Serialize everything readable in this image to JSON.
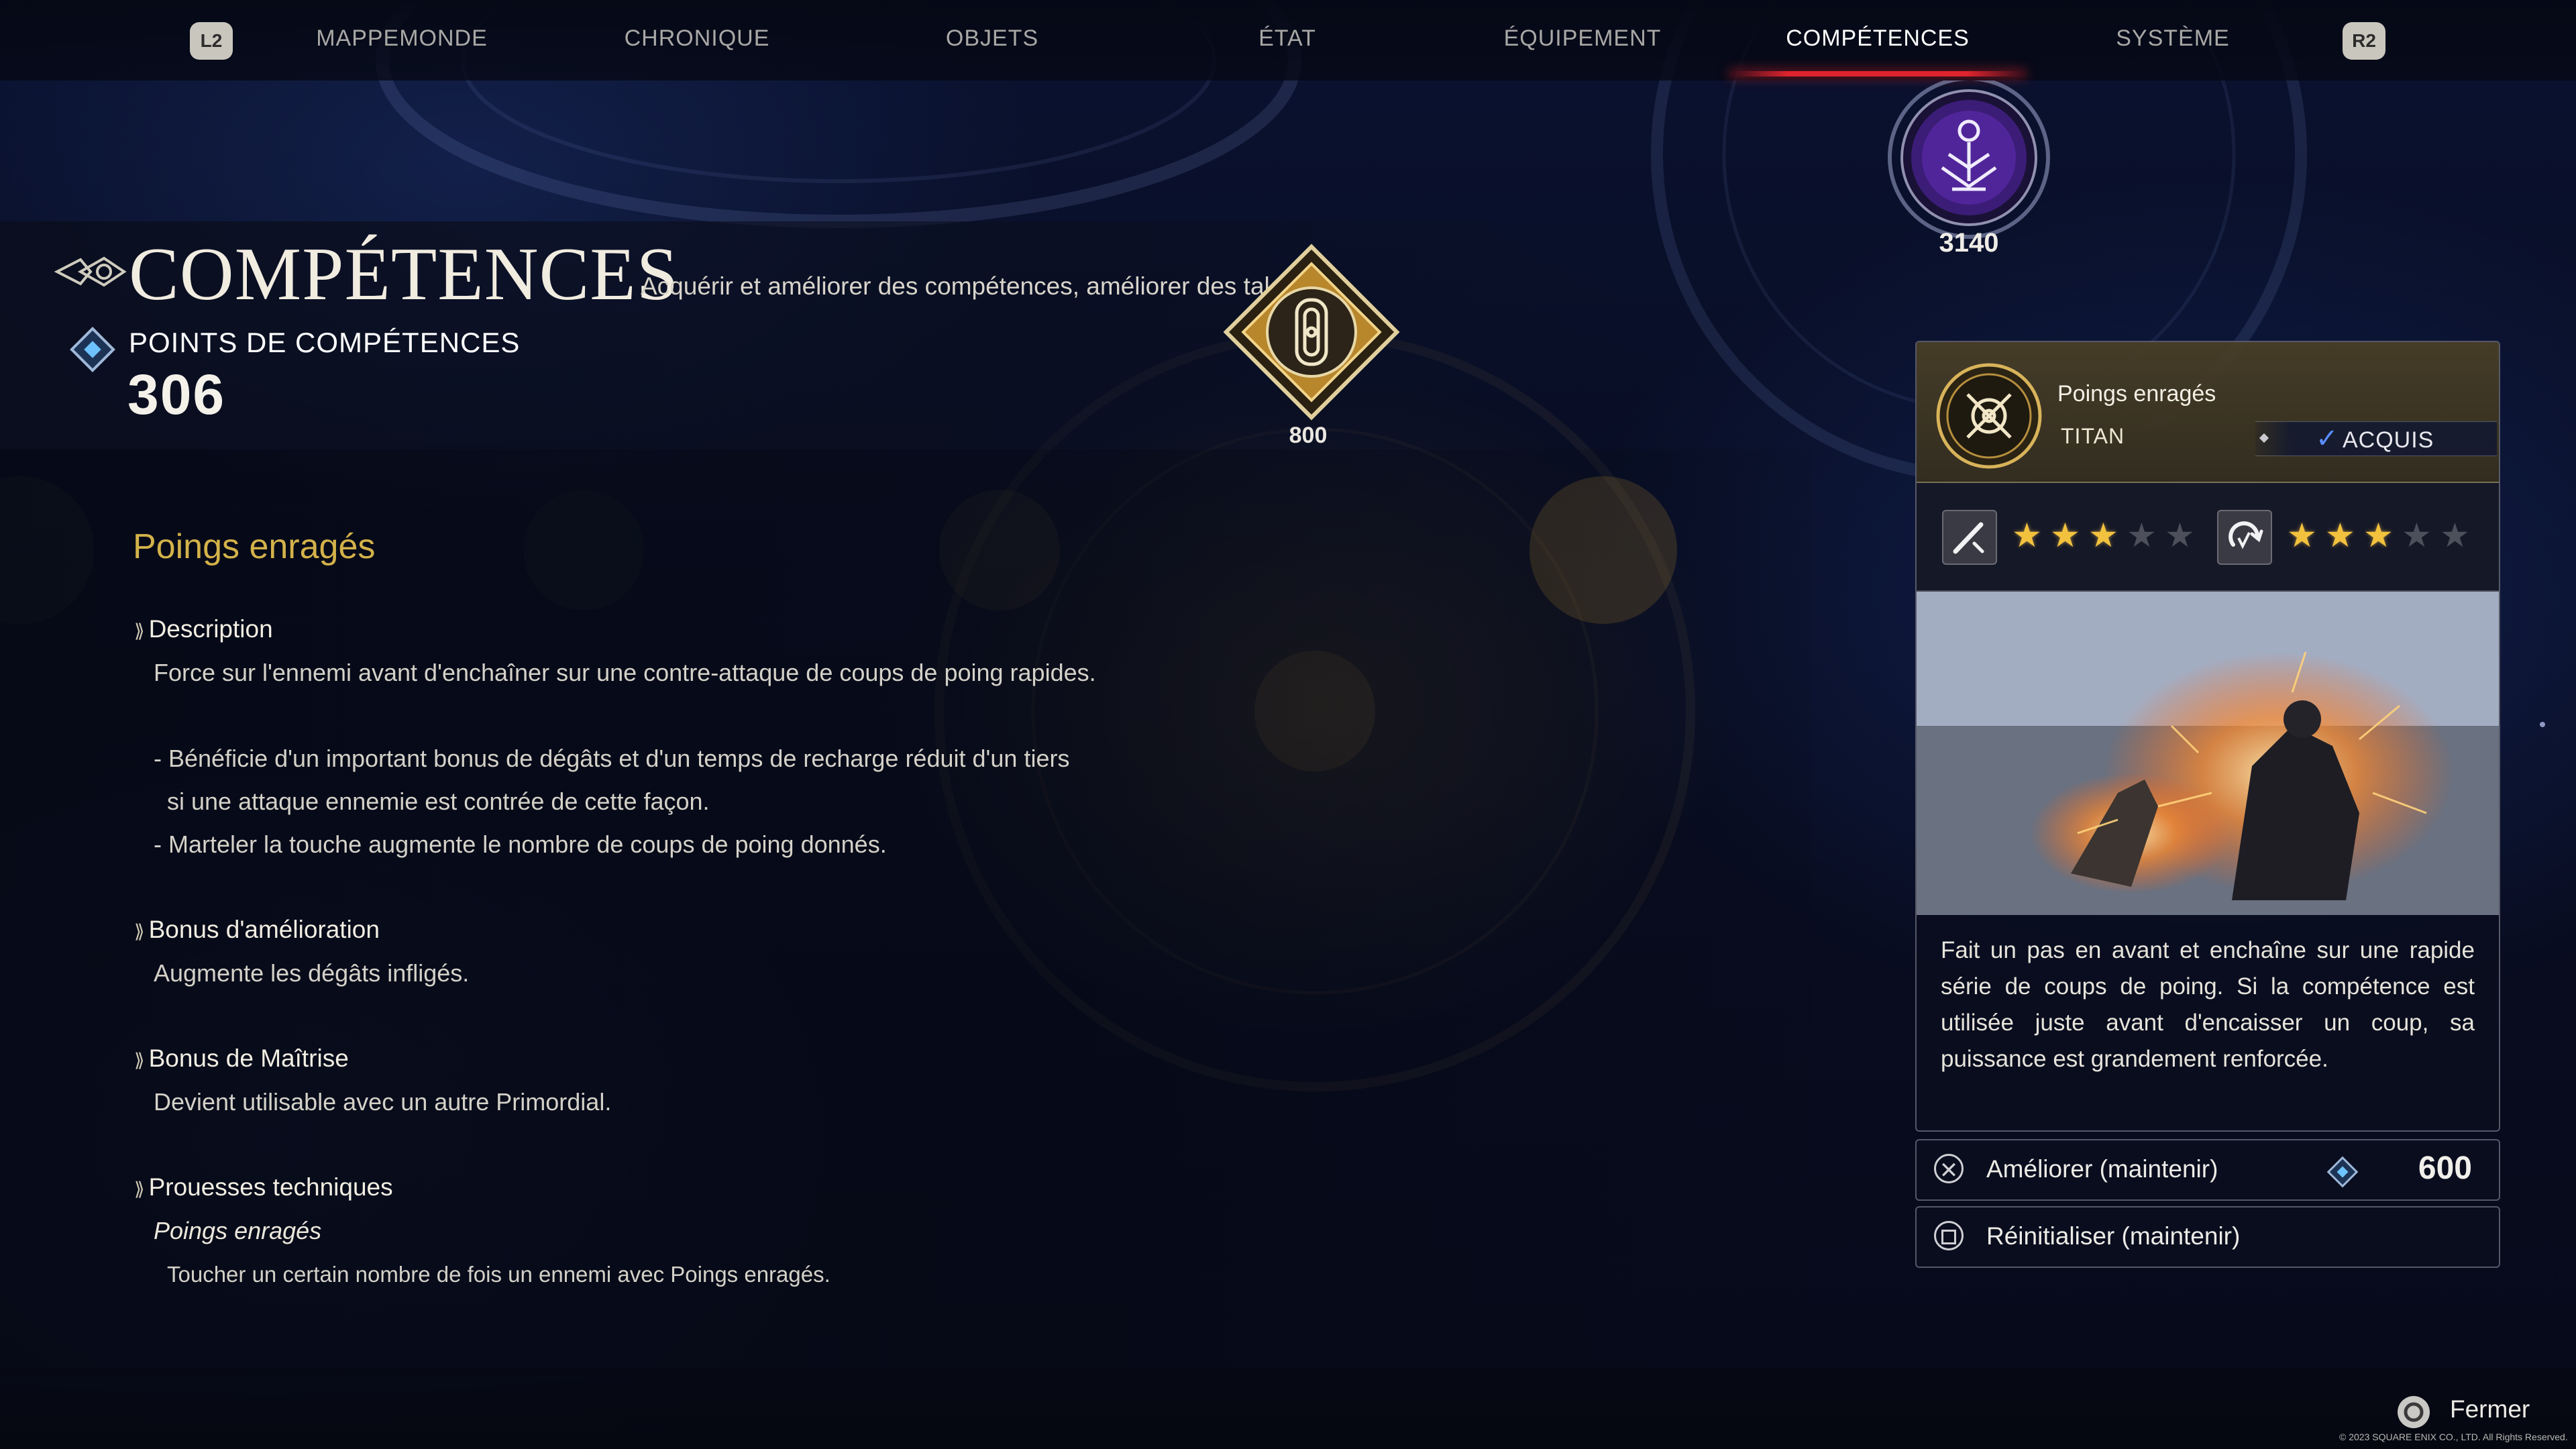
{
  "nav": {
    "left_button": "L2",
    "right_button": "R2",
    "tabs": [
      {
        "label": "MAPPEMONDE"
      },
      {
        "label": "CHRONIQUE"
      },
      {
        "label": "OBJETS"
      },
      {
        "label": "ÉTAT"
      },
      {
        "label": "ÉQUIPEMENT"
      },
      {
        "label": "COMPÉTENCES",
        "active": true
      },
      {
        "label": "SYSTÈME"
      }
    ]
  },
  "header": {
    "title": "COMPÉTENCES",
    "subtitle": "Acquérir et améliorer des compétences, améliorer des talents.",
    "points_label": "POINTS DE COMPÉTENCES",
    "points_value": "306"
  },
  "node": {
    "cost": "800"
  },
  "eikon_badge": {
    "value": "3140"
  },
  "ability": {
    "name": "Poings enragés",
    "description_heading": "Description",
    "description_lines": [
      "Force sur l'ennemi avant d'enchaîner sur une contre-attaque de coups de poing rapides.",
      "- Bénéficie d'un important bonus de dégâts et d'un temps de recharge réduit d'un tiers",
      "  si une attaque ennemie est contrée de cette façon.",
      "- Marteler la touche augmente le nombre de coups de poing donnés."
    ],
    "upgrade_heading": "Bonus d'amélioration",
    "upgrade_text": "Augmente les dégâts infligés.",
    "mastery_heading": "Bonus de Maîtrise",
    "mastery_text": "Devient utilisable avec un autre Primordial.",
    "feats_heading": "Prouesses techniques",
    "feat_name": "Poings enragés",
    "feat_text": "Toucher un certain nombre de fois un ennemi avec Poings enragés."
  },
  "panel": {
    "ability_name": "Poings enragés",
    "eikon": "TITAN",
    "status": "ACQUIS",
    "rating_attack": 3,
    "rating_recovery": 3,
    "rating_max": 5,
    "description": "Fait un pas en avant et enchaîne sur une rapide série de coups de poing. Si la compétence est utilisée juste avant d'encaisser un coup, sa puissance est grandement renforcée."
  },
  "actions": {
    "upgrade_label": "Améliorer (maintenir)",
    "upgrade_cost": "600",
    "reset_label": "Réinitialiser (maintenir)"
  },
  "footer": {
    "close_label": "Fermer",
    "copyright": "© 2023 SQUARE ENIX CO., LTD. All Rights Reserved."
  },
  "colors": {
    "accent_gold": "#d4b24a",
    "active_tab_underline": "#e0242d",
    "star_on": "#f2c23e",
    "acquired_check": "#5a8cff",
    "eikon_purple": "#5b2aa8"
  }
}
